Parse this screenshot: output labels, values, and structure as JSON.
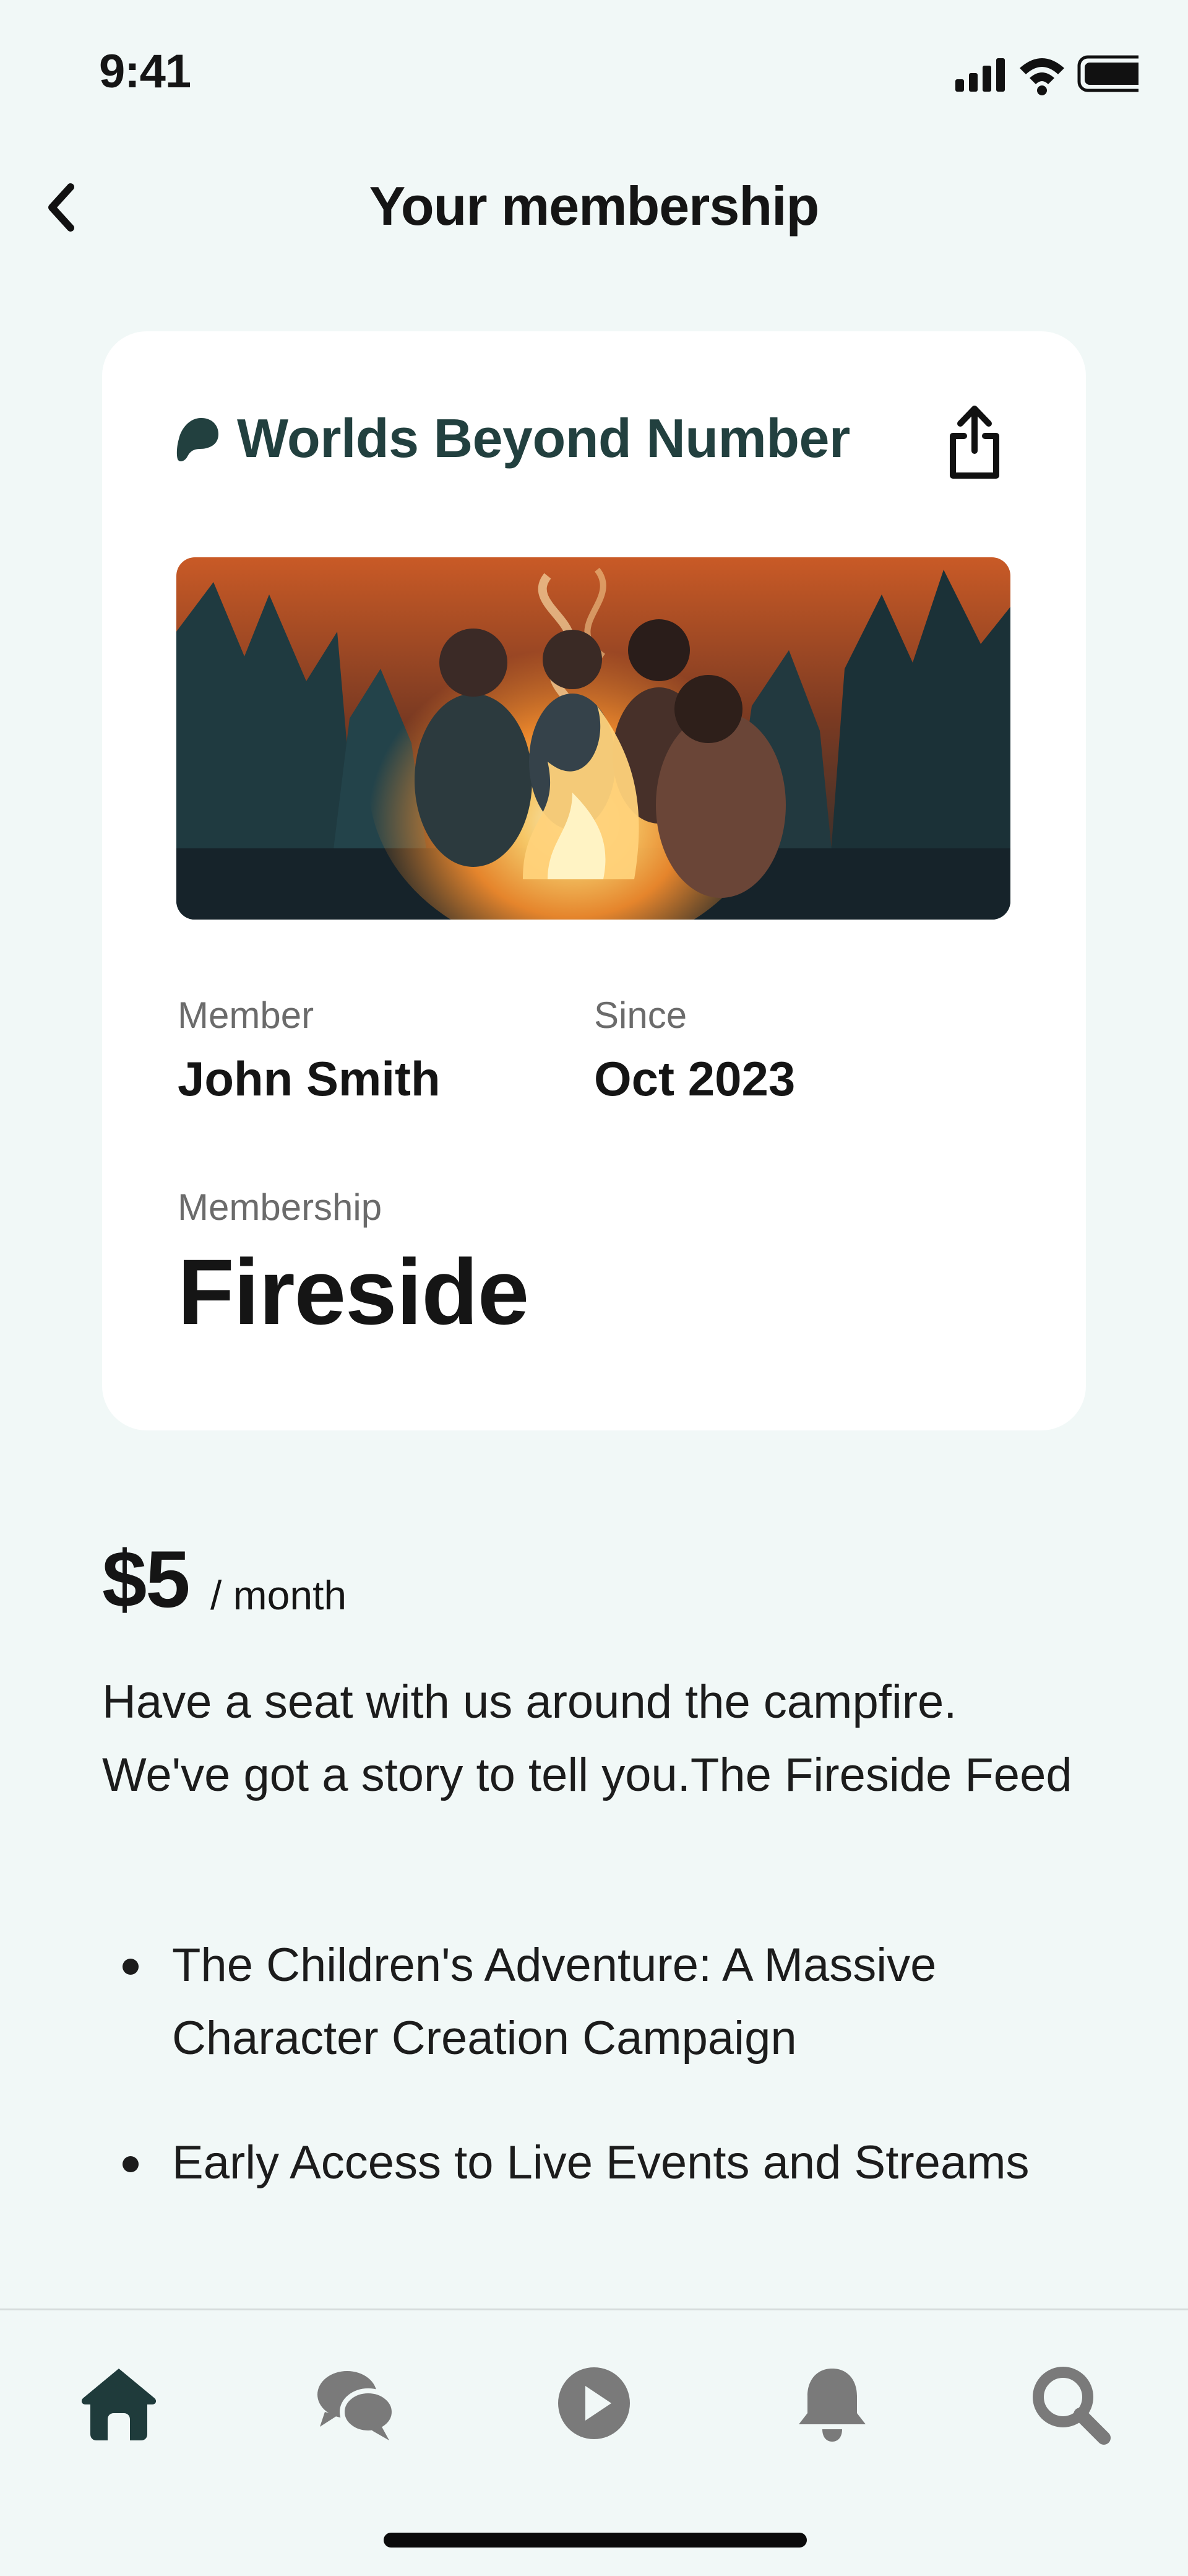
{
  "status_bar": {
    "time": "9:41"
  },
  "nav": {
    "title": "Your membership"
  },
  "card": {
    "brand_name": "Worlds Beyond Number",
    "member_label": "Member",
    "member_value": "John Smith",
    "since_label": "Since",
    "since_value": "Oct 2023",
    "membership_label": "Membership",
    "membership_value": "Fireside"
  },
  "pricing": {
    "price": "$5",
    "period": "/ month",
    "description": "Have a seat with us around the campfire. We've got a story to tell you.The Fireside Feed",
    "benefits": [
      "The Children's Adventure: A Massive Character Creation Campaign",
      "Early Access to Live Events and Streams"
    ]
  },
  "tabbar": {
    "tabs": [
      {
        "icon": "home-icon",
        "active": true
      },
      {
        "icon": "chat-bubbles-icon",
        "active": false
      },
      {
        "icon": "play-icon",
        "active": false
      },
      {
        "icon": "bell-icon",
        "active": false
      },
      {
        "icon": "search-icon",
        "active": false
      }
    ]
  },
  "colors": {
    "background": "#f1f8f7",
    "brand": "#22403f",
    "active_tab": "#1f3b3b",
    "inactive_tab": "#7a7a7a"
  }
}
